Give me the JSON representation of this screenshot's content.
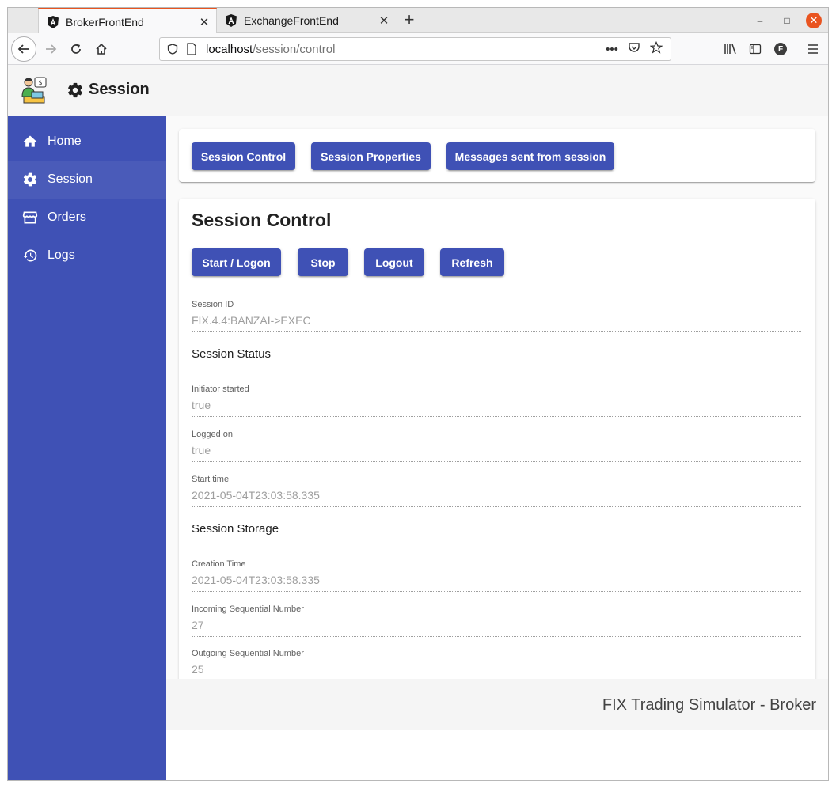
{
  "browser": {
    "tabs": [
      {
        "title": "BrokerFrontEnd",
        "close": "✕"
      },
      {
        "title": "ExchangeFrontEnd",
        "close": "✕"
      }
    ],
    "new_tab": "+",
    "url_host": "localhost",
    "url_path": "/session/control",
    "url_more": "•••",
    "window_min": "–",
    "window_max": "□",
    "window_close": "✕",
    "profile_initial": "F"
  },
  "app": {
    "toolbar_title": "Session",
    "sidenav": [
      {
        "label": "Home",
        "icon": "home-icon"
      },
      {
        "label": "Session",
        "icon": "gear-icon"
      },
      {
        "label": "Orders",
        "icon": "storefront-icon"
      },
      {
        "label": "Logs",
        "icon": "history-icon"
      }
    ],
    "tabs_buttons": [
      "Session Control",
      "Session Properties",
      "Messages sent from session"
    ],
    "card_title": "Session Control",
    "action_buttons": [
      "Start / Logon",
      "Stop",
      "Logout",
      "Refresh"
    ],
    "session_id_label": "Session ID",
    "session_id_value": "FIX.4.4:BANZAI->EXEC",
    "status_section": "Session Status",
    "initiator_label": "Initiator started",
    "initiator_value": "true",
    "logged_on_label": "Logged on",
    "logged_on_value": "true",
    "start_time_label": "Start time",
    "start_time_value": "2021-05-04T23:03:58.335",
    "storage_section": "Session Storage",
    "creation_time_label": "Creation Time",
    "creation_time_value": "2021-05-04T23:03:58.335",
    "incoming_label": "Incoming Sequential Number",
    "incoming_value": "27",
    "outgoing_label": "Outgoing Sequential Number",
    "outgoing_value": "25",
    "footer": "FIX Trading Simulator - Broker"
  },
  "colors": {
    "primary": "#3f51b5",
    "accent_tab": "#e95420"
  }
}
